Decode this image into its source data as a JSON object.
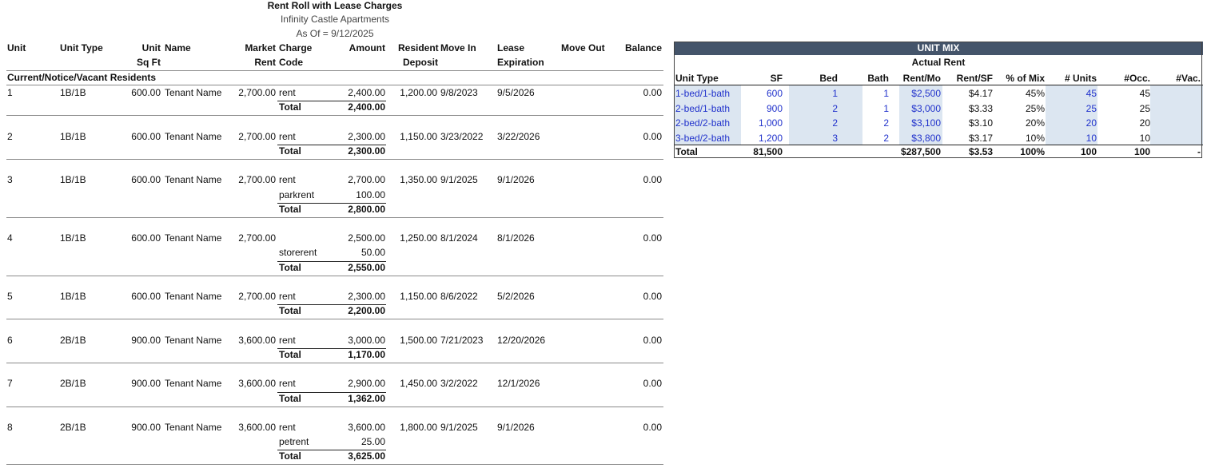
{
  "report": {
    "title": "Rent Roll with Lease Charges",
    "property": "Infinity Castle Apartments",
    "as_of": "As Of = 9/12/2025"
  },
  "headers": {
    "unit": "Unit",
    "unit_type": "Unit Type",
    "unit_sqft_1": "Unit",
    "unit_sqft_2": "Sq Ft",
    "name": "Name",
    "market_rent_1": "Market",
    "market_rent_2": "Rent",
    "charge_code_1": "Charge",
    "charge_code_2": "Code",
    "amount": "Amount",
    "deposit_1": "Resident",
    "deposit_2": "Deposit",
    "move_in": "Move In",
    "lease_exp_1": "Lease",
    "lease_exp_2": "Expiration",
    "move_out": "Move Out",
    "balance": "Balance"
  },
  "section_label": "Current/Notice/Vacant Residents",
  "total_label": "Total",
  "units": [
    {
      "unit": "1",
      "type": "1B/1B",
      "sqft": "600.00",
      "name": "Tenant Name",
      "market": "2,700.00",
      "deposit": "1,200.00",
      "move_in": "9/8/2023",
      "lease_exp": "9/5/2026",
      "balance": "0.00",
      "charges": [
        {
          "code": "rent",
          "amount": "2,400.00"
        }
      ],
      "total": "2,400.00"
    },
    {
      "unit": "2",
      "type": "1B/1B",
      "sqft": "600.00",
      "name": "Tenant Name",
      "market": "2,700.00",
      "deposit": "1,150.00",
      "move_in": "3/23/2022",
      "lease_exp": "3/22/2026",
      "balance": "0.00",
      "charges": [
        {
          "code": "rent",
          "amount": "2,300.00"
        }
      ],
      "total": "2,300.00"
    },
    {
      "unit": "3",
      "type": "1B/1B",
      "sqft": "600.00",
      "name": "Tenant Name",
      "market": "2,700.00",
      "deposit": "1,350.00",
      "move_in": "9/1/2025",
      "lease_exp": "9/1/2026",
      "balance": "0.00",
      "charges": [
        {
          "code": "rent",
          "amount": "2,700.00"
        },
        {
          "code": "parkrent",
          "amount": "100.00"
        }
      ],
      "total": "2,800.00"
    },
    {
      "unit": "4",
      "type": "1B/1B",
      "sqft": "600.00",
      "name": "Tenant Name",
      "market": "2,700.00",
      "deposit": "1,250.00",
      "move_in": "8/1/2024",
      "lease_exp": "8/1/2026",
      "balance": "0.00",
      "charges": [
        {
          "code": "",
          "amount": "2,500.00"
        },
        {
          "code": "storerent",
          "amount": "50.00"
        }
      ],
      "total": "2,550.00"
    },
    {
      "unit": "5",
      "type": "1B/1B",
      "sqft": "600.00",
      "name": "Tenant Name",
      "market": "2,700.00",
      "deposit": "1,150.00",
      "move_in": "8/6/2022",
      "lease_exp": "5/2/2026",
      "balance": "0.00",
      "charges": [
        {
          "code": "rent",
          "amount": "2,300.00"
        }
      ],
      "total": "2,200.00"
    },
    {
      "unit": "6",
      "type": "2B/1B",
      "sqft": "900.00",
      "name": "Tenant Name",
      "market": "3,600.00",
      "deposit": "1,500.00",
      "move_in": "7/21/2023",
      "lease_exp": "12/20/2026",
      "balance": "0.00",
      "charges": [
        {
          "code": "rent",
          "amount": "3,000.00"
        }
      ],
      "total": "1,170.00"
    },
    {
      "unit": "7",
      "type": "2B/1B",
      "sqft": "900.00",
      "name": "Tenant Name",
      "market": "3,600.00",
      "deposit": "1,450.00",
      "move_in": "3/2/2022",
      "lease_exp": "12/1/2026",
      "balance": "0.00",
      "charges": [
        {
          "code": "rent",
          "amount": "2,900.00"
        }
      ],
      "total": "1,362.00"
    },
    {
      "unit": "8",
      "type": "2B/1B",
      "sqft": "900.00",
      "name": "Tenant Name",
      "market": "3,600.00",
      "deposit": "1,800.00",
      "move_in": "9/1/2025",
      "lease_exp": "9/1/2026",
      "balance": "0.00",
      "charges": [
        {
          "code": "rent",
          "amount": "3,600.00"
        },
        {
          "code": "petrent",
          "amount": "25.00"
        }
      ],
      "total": "3,625.00"
    }
  ],
  "unit_mix": {
    "title": "UNIT MIX",
    "subtitle": "Actual Rent",
    "columns": [
      "Unit Type",
      "SF",
      "Bed",
      "Bath",
      "Rent/Mo",
      "Rent/SF",
      "% of Mix",
      "# Units",
      "#Occ.",
      "#Vac."
    ],
    "rows": [
      [
        "1-bed/1-bath",
        "600",
        "1",
        "1",
        "$2,500",
        "$4.17",
        "45%",
        "45",
        "45",
        ""
      ],
      [
        "2-bed/1-bath",
        "900",
        "2",
        "1",
        "$3,000",
        "$3.33",
        "25%",
        "25",
        "25",
        ""
      ],
      [
        "2-bed/2-bath",
        "1,000",
        "2",
        "2",
        "$3,100",
        "$3.10",
        "20%",
        "20",
        "20",
        ""
      ],
      [
        "3-bed/2-bath",
        "1,200",
        "3",
        "2",
        "$3,800",
        "$3.17",
        "10%",
        "10",
        "10",
        ""
      ]
    ],
    "total": [
      "Total",
      "81,500",
      "",
      "",
      "$287,500",
      "$3.53",
      "100%",
      "100",
      "100",
      "-"
    ],
    "colors": {
      "header_band": "#44546a",
      "input_text": "#2233cc",
      "input_fill": "#dce6f1"
    }
  }
}
